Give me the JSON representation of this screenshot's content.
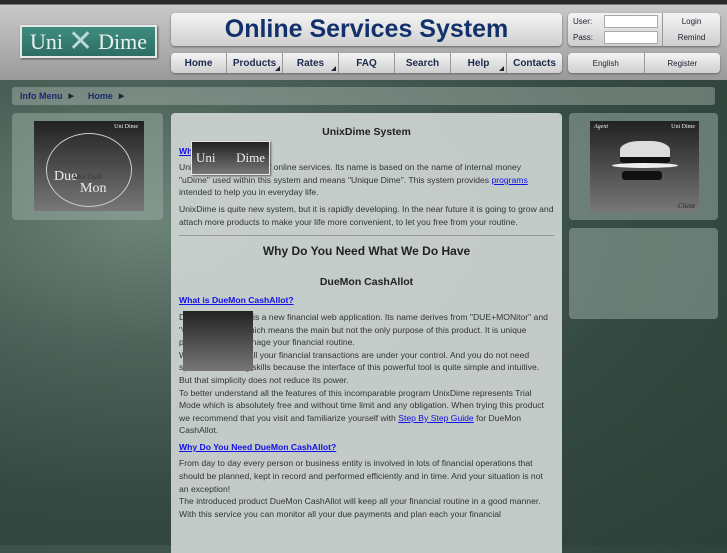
{
  "logo": {
    "left": "Uni",
    "right": "Dime"
  },
  "header": {
    "title": "Online Services System"
  },
  "nav": [
    "Home",
    "Products",
    "Rates",
    "FAQ",
    "Search",
    "Help",
    "Contacts"
  ],
  "login": {
    "user_label": "User:",
    "pass_label": "Pass:",
    "login": "Login",
    "remind": "Remind",
    "user_value": "",
    "pass_value": ""
  },
  "lang": {
    "english": "English",
    "register": "Register"
  },
  "breadcrumb": [
    "Info Menu",
    "Home"
  ],
  "left_image": {
    "brand": "Uni Dime",
    "title_top": "Due",
    "title_bottom": "Mon",
    "script": "Allot Cash"
  },
  "right_image": {
    "left": "Agent",
    "brand": "Uni Dime",
    "bottom": "Client"
  },
  "main": {
    "h1": "UnixDime System",
    "q1": "What is UnixDime?",
    "p1a": "UnixDime is a system of online services. Its name is based on the name of internal money \"uDime\" used within this system and means \"Unique Dime\". This system provides ",
    "p1link": "programs",
    "p1b": " intended to help you in everyday life.",
    "p2": "UnixDime is quite new system, but it is rapidly developing. In the near future it is going to grow and attach more products to make your life more convenient, to let you free from your routine.",
    "h2": "Why Do You Need What We Do Have",
    "h3": "DueMon CashAllot",
    "q2": "What is DueMon CashAllot?",
    "p3": "DueMon CashAllot is a new financial web application. Its name derives from \"DUE+MONitor\" and \"CASH+ALLOT\" which means the main but not the only purpose of this product. It is unique powerful tool to manage your financial routine.",
    "p4": "With this program all your financial transactions are under your control. And you do not need special accounting skills because the interface of this powerful tool is quite simple and intuitive. But that simplicity does not reduce its power.",
    "p5a": "To better understand all the features of this incomparable program UnixDime represents Trial Mode which is absolutely free and without time limit and any obligation. When trying this product we recommend that you visit and familiarize yourself with ",
    "p5link": "Step By Step Guide",
    "p5b": " for DueMon CashAllot.",
    "q3": "Why Do You Need DueMon CashAllot?",
    "p6": "From day to day every person or business entity is involved in lots of financial operations that should be planned, kept in record and performed efficiently and in time. And your situation is not an exception!",
    "p7": "The introduced product DueMon CashAllot will keep all your financial routine in a good manner. With this service you can monitor all your due payments and plan each your financial"
  }
}
